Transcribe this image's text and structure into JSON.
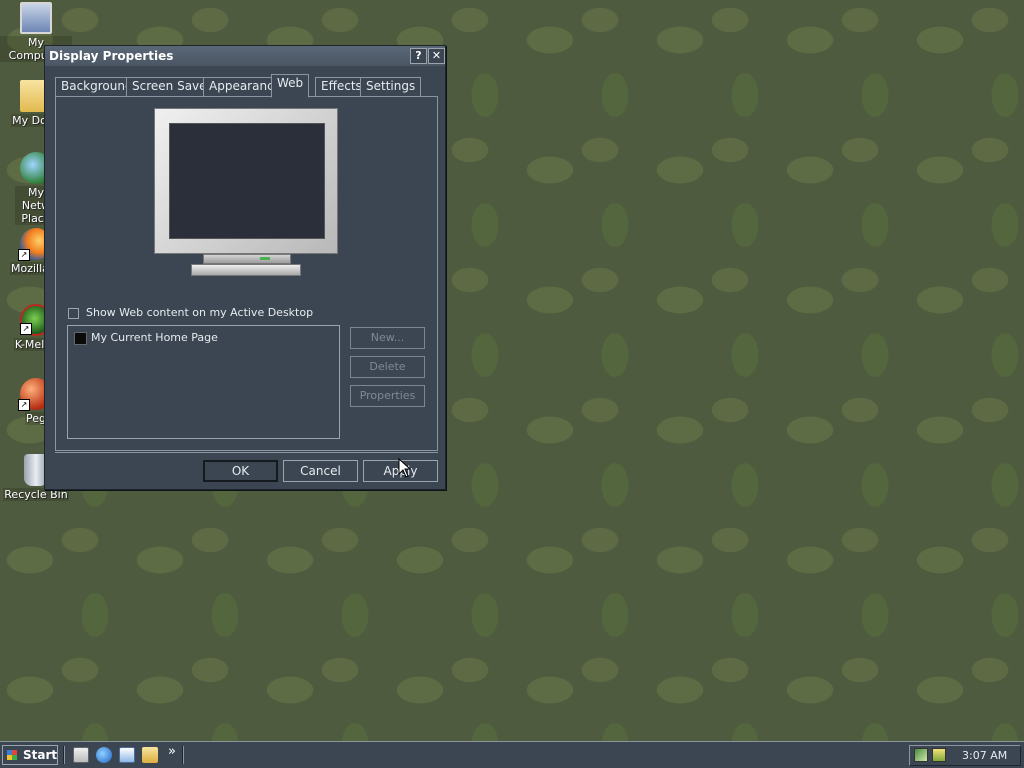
{
  "desktop": {
    "icons": [
      {
        "label": "My Computer",
        "icon": "computer-icon"
      },
      {
        "label": "My Docu",
        "icon": "folder-icon"
      },
      {
        "label": "My Netw Place",
        "icon": "network-places-icon"
      },
      {
        "label": "Mozilla Fi",
        "icon": "firefox-icon"
      },
      {
        "label": "K-Melec",
        "icon": "k-meleon-icon"
      },
      {
        "label": "Peg",
        "icon": "pegasus-icon"
      },
      {
        "label": "Recycle Bin",
        "icon": "recycle-bin-icon"
      }
    ]
  },
  "dialog": {
    "title": "Display Properties",
    "help_btn": "?",
    "close_btn": "✕",
    "tabs": [
      "Background",
      "Screen Saver",
      "Appearance",
      "Web",
      "Effects",
      "Settings"
    ],
    "active_tab": "Web",
    "web": {
      "show_web_content_label": "Show Web content on my Active Desktop",
      "show_web_content_checked": false,
      "list_items": [
        {
          "label": "My Current Home Page",
          "checked": false
        }
      ],
      "new_button": "New...",
      "delete_button": "Delete",
      "properties_button": "Properties"
    },
    "ok_button": "OK",
    "cancel_button": "Cancel",
    "apply_button": "Apply"
  },
  "taskbar": {
    "start_label": "Start",
    "quicklaunch_chevron": "»",
    "clock": "3:07 AM"
  },
  "colors": {
    "dialog_bg": "#3c4652",
    "desktop_bg": "#4e5b3e",
    "text": "#e6ebf0"
  }
}
